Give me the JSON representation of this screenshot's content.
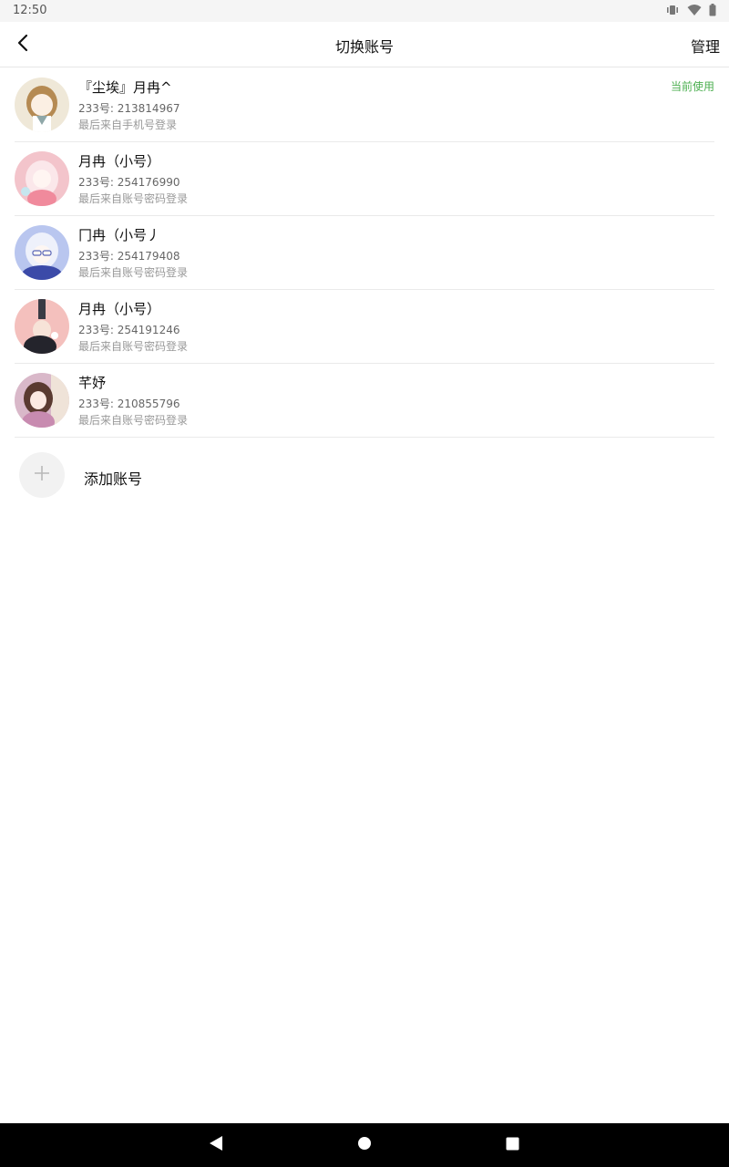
{
  "status_bar": {
    "time": "12:50",
    "icons": [
      "vibrate-icon",
      "wifi-icon",
      "battery-icon"
    ]
  },
  "app_bar": {
    "back_icon": "back-arrow-icon",
    "title": "切换账号",
    "manage_label": "管理"
  },
  "accounts": [
    {
      "name": "『尘埃』月冉^",
      "id_text": "233号: 213814967",
      "login_text": "最后来自手机号登录",
      "current_label": "当前使用",
      "avatar_color": "#efe8d8"
    },
    {
      "name": "月冉（小号）",
      "id_text": "233号: 254176990",
      "login_text": "最后来自账号密码登录",
      "avatar_color": "#f3c4cb"
    },
    {
      "name": "冂冉（小号丿",
      "id_text": "233号: 254179408",
      "login_text": "最后来自账号密码登录",
      "avatar_color": "#b9c6ef"
    },
    {
      "name": "月冉（小号）",
      "id_text": "233号: 254191246",
      "login_text": "最后来自账号密码登录",
      "avatar_color": "#f4c0bd"
    },
    {
      "name": "芊妤",
      "id_text": "233号: 210855796",
      "login_text": "最后来自账号密码登录",
      "avatar_color": "#d9b8c9"
    }
  ],
  "add_account": {
    "label": "添加账号",
    "icon": "plus-icon"
  },
  "nav_bar": {
    "buttons": [
      "nav-back-icon",
      "nav-home-icon",
      "nav-recents-icon"
    ]
  },
  "colors": {
    "accent_green": "#4caf50",
    "divider": "#eaeaea"
  }
}
